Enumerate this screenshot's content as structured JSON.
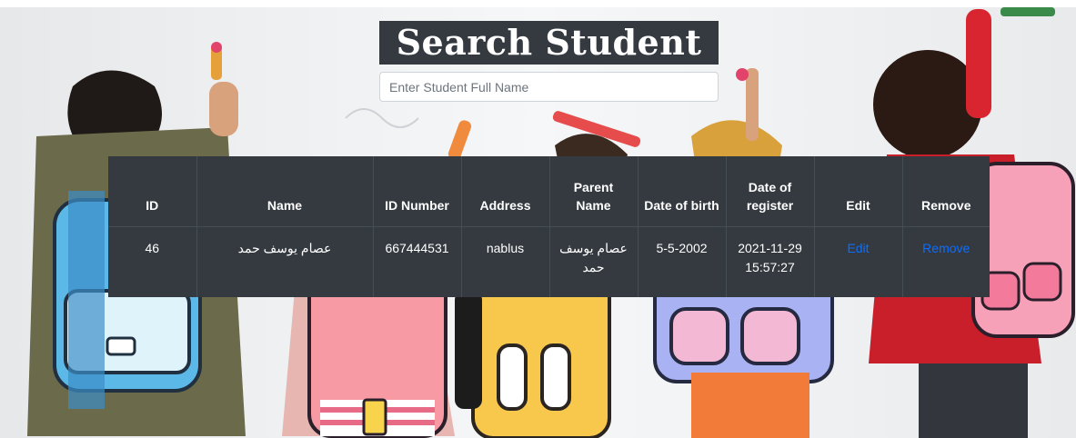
{
  "page": {
    "title": "Search Student",
    "search": {
      "placeholder": "Enter Student Full Name",
      "value": ""
    }
  },
  "table": {
    "headers": {
      "id": "ID",
      "name": "Name",
      "id_number": "ID Number",
      "address": "Address",
      "parent_name": "Parent Name",
      "dob": "Date of birth",
      "date_register": "Date of register",
      "edit": "Edit",
      "remove": "Remove"
    },
    "rows": [
      {
        "id": "46",
        "name": "عصام يوسف حمد",
        "id_number": "667444531",
        "address": "nablus",
        "parent_name": "عصام يوسف حمد",
        "dob": "5-5-2002",
        "date_register": "2021-11-29 15:57:27",
        "edit": "Edit",
        "remove": "Remove"
      }
    ]
  },
  "colors": {
    "dark": "#343a40",
    "border": "#454d55",
    "link": "#0d6efd",
    "text": "#ffffff"
  }
}
